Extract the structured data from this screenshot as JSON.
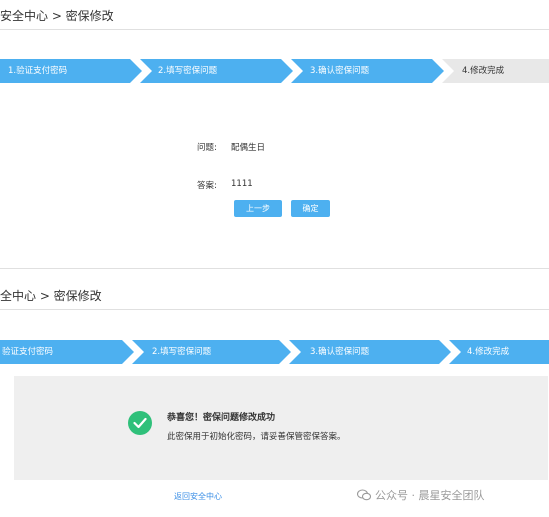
{
  "top": {
    "breadcrumb": "安全中心 > 密保修改",
    "steps": [
      "1.验证支付密码",
      "2.填写密保问题",
      "3.确认密保问题",
      "4.修改完成"
    ],
    "question_label": "问题:",
    "question_value": "配偶生日",
    "answer_label": "答案:",
    "answer_value": "1111",
    "prev_button": "上一步",
    "confirm_button": "确定"
  },
  "bottom": {
    "breadcrumb": "全中心 > 密保修改",
    "steps": [
      "验证支付密码",
      "2.填写密保问题",
      "3.确认密保问题",
      "4.修改完成"
    ],
    "success_title": "恭喜您！密保问题修改成功",
    "success_message": "此密保用于初始化密码，请妥善保管密保答案。",
    "back_link": "返回安全中心"
  },
  "watermark": {
    "text": "公众号 · 晨星安全团队",
    "icon": "wechat-icon"
  },
  "colors": {
    "step_active": "#4db0f0",
    "step_inactive": "#e8e8e8",
    "success_green": "#2fc07a",
    "link": "#3a8ee6"
  }
}
